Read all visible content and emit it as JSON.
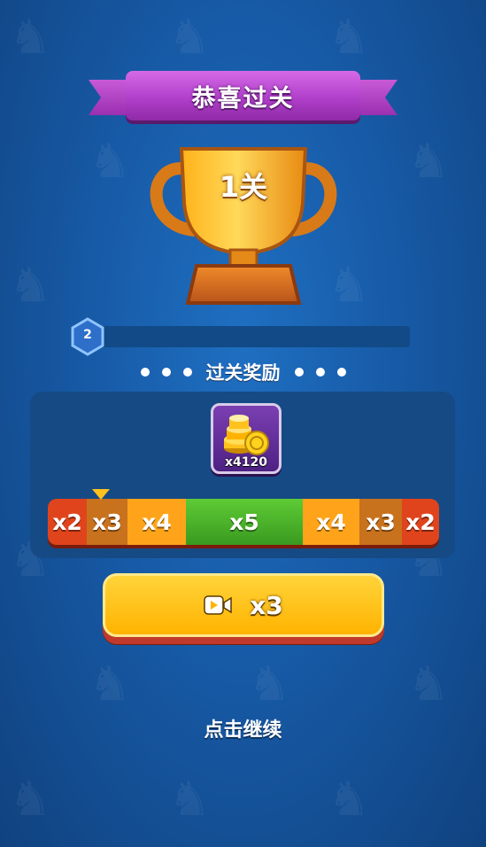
{
  "header": {
    "title": "恭喜过关"
  },
  "trophy": {
    "level_label": "1关"
  },
  "level": {
    "number": "2",
    "progress_fraction": 0
  },
  "rewards_section": {
    "title": "过关奖励"
  },
  "reward_item": {
    "icon": "gold-coins-icon",
    "amount": "x4120"
  },
  "multiplier_bar": {
    "segments": [
      {
        "label": "x2",
        "color": "#e0441c"
      },
      {
        "label": "x3",
        "color": "#c8721e"
      },
      {
        "label": "x4",
        "color": "#ffa41a"
      },
      {
        "label": "x5",
        "color": "#4caf2a"
      },
      {
        "label": "x4",
        "color": "#ffa41a"
      },
      {
        "label": "x3",
        "color": "#c8721e"
      },
      {
        "label": "x2",
        "color": "#e0441c"
      }
    ],
    "selected_index": 1
  },
  "video_button": {
    "icon": "video-camera-icon",
    "label": "x3"
  },
  "continue_text": "点击继续",
  "colors": {
    "accent": "#ffb300",
    "ribbon": "#b13fcb",
    "background": "#175aa6"
  }
}
